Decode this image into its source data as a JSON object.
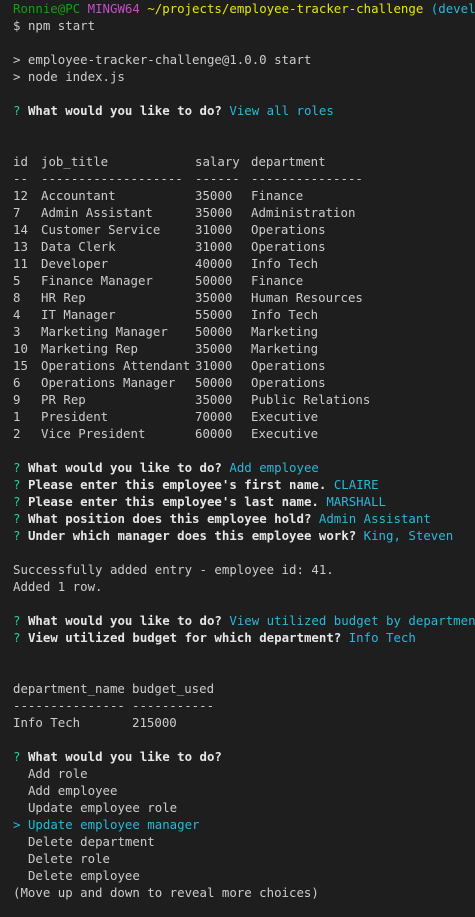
{
  "prompt": {
    "user_host": "Ronnie@PC",
    "shell": "MINGW64",
    "path": "~/projects/employee-tracker-challenge",
    "branch": "(develop)",
    "dollar": "$",
    "command": "npm start"
  },
  "npm": {
    "line1": "> employee-tracker-challenge@1.0.0 start",
    "line2": "> node index.js"
  },
  "q_mark": "?",
  "q_main": "What would you like to do?",
  "answer_view_roles": "View all roles",
  "roles_table": {
    "headers": [
      "id",
      "job_title",
      "salary",
      "department"
    ],
    "separators": [
      "--",
      "-------------------",
      "------",
      "---------------"
    ],
    "rows": [
      [
        "12",
        "Accountant",
        "35000",
        "Finance"
      ],
      [
        "7",
        "Admin Assistant",
        "35000",
        "Administration"
      ],
      [
        "14",
        "Customer Service",
        "31000",
        "Operations"
      ],
      [
        "13",
        "Data Clerk",
        "31000",
        "Operations"
      ],
      [
        "11",
        "Developer",
        "40000",
        "Info Tech"
      ],
      [
        "5",
        "Finance Manager",
        "50000",
        "Finance"
      ],
      [
        "8",
        "HR Rep",
        "35000",
        "Human Resources"
      ],
      [
        "4",
        "IT Manager",
        "55000",
        "Info Tech"
      ],
      [
        "3",
        "Marketing Manager",
        "50000",
        "Marketing"
      ],
      [
        "10",
        "Marketing Rep",
        "35000",
        "Marketing"
      ],
      [
        "15",
        "Operations Attendant",
        "31000",
        "Operations"
      ],
      [
        "6",
        "Operations Manager",
        "50000",
        "Operations"
      ],
      [
        "9",
        "PR Rep",
        "35000",
        "Public Relations"
      ],
      [
        "1",
        "President",
        "70000",
        "Executive"
      ],
      [
        "2",
        "Vice President",
        "60000",
        "Executive"
      ]
    ]
  },
  "add_employee": {
    "answer": "Add employee",
    "q_first": "Please enter this employee's first name.",
    "a_first": "CLAIRE",
    "q_last": "Please enter this employee's last name.",
    "a_last": "MARSHALL",
    "q_position": "What position does this employee hold?",
    "a_position": "Admin Assistant",
    "q_manager": "Under which manager does this employee work?",
    "a_manager": "King, Steven",
    "success": "Successfully added entry - employee id: 41.",
    "added": "Added 1 row."
  },
  "budget": {
    "answer": "View utilized budget by department",
    "q_dept": "View utilized budget for which department?",
    "a_dept": "Info Tech",
    "headers": [
      "department_name",
      "budget_used"
    ],
    "separators": [
      "---------------",
      "-----------"
    ],
    "rows": [
      [
        "Info Tech",
        "215000"
      ]
    ]
  },
  "menu": {
    "pointer": ">",
    "items": [
      "Add role",
      "Add employee",
      "Update employee role",
      "Update employee manager",
      "Delete department",
      "Delete role",
      "Delete employee"
    ],
    "selected_index": 3,
    "hint": "(Move up and down to reveal more choices)"
  }
}
